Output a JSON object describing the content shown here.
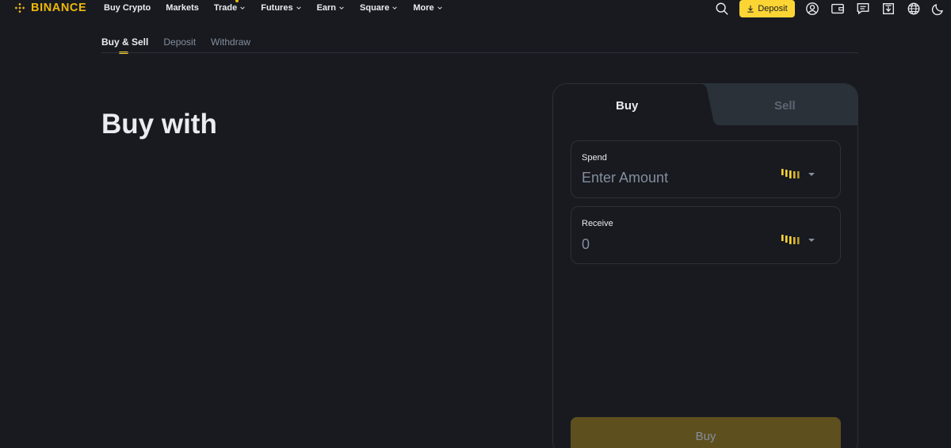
{
  "brand": {
    "name": "BINANCE",
    "color": "#f0b90b"
  },
  "nav": {
    "items": [
      {
        "label": "Buy Crypto",
        "has_dropdown": false
      },
      {
        "label": "Markets",
        "has_dropdown": false
      },
      {
        "label": "Trade",
        "has_dropdown": true
      },
      {
        "label": "Futures",
        "has_dropdown": true
      },
      {
        "label": "Earn",
        "has_dropdown": true
      },
      {
        "label": "Square",
        "has_dropdown": true
      },
      {
        "label": "More",
        "has_dropdown": true
      }
    ],
    "deposit_label": "Deposit",
    "icons": [
      "search-icon",
      "download-icon",
      "user-icon",
      "wallet-icon",
      "message-icon",
      "upload-icon",
      "globe-icon",
      "moon-icon"
    ]
  },
  "subtabs": {
    "items": [
      "Buy & Sell",
      "Deposit",
      "Withdraw"
    ],
    "active": "Buy & Sell"
  },
  "hero": {
    "title": "Buy with"
  },
  "trade_card": {
    "tabs": {
      "buy": "Buy",
      "sell": "Sell",
      "active": "Buy"
    },
    "spend": {
      "label": "Spend",
      "placeholder": "Enter Amount"
    },
    "receive": {
      "label": "Receive",
      "value": "0"
    },
    "submit_label": "Buy"
  },
  "colors": {
    "background": "#181a20",
    "accent": "#fcd535",
    "panel": "#2b3139",
    "muted_text": "#848e9c"
  }
}
